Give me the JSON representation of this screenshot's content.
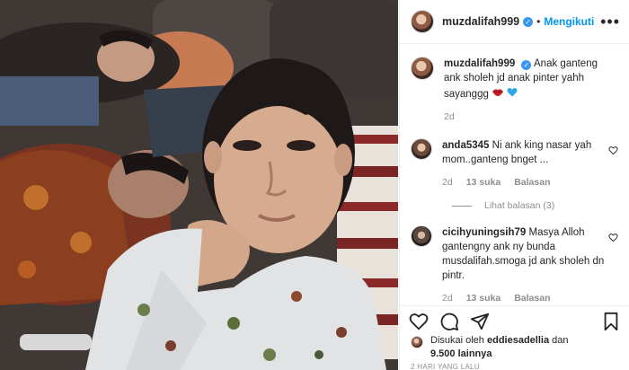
{
  "post": {
    "username": "muzdalifah999",
    "dot": "•",
    "follow_label": "Mengikuti",
    "more_label": "•••",
    "caption_text": "Anak ganteng ank sholeh jd anak pinter yahh sayanggg",
    "caption_emoji": [
      "lips-emoji",
      "blue-heart-emoji"
    ],
    "caption_age": "2d"
  },
  "comments": [
    {
      "username": "anda5345",
      "text": "Ni ank king nasar yah mom..ganteng bnget ...",
      "age": "2d",
      "likes": "13 suka",
      "reply_label": "Balasan",
      "view_replies": "Lihat balasan (3)"
    },
    {
      "username": "cicihyuningsih79",
      "text": "Masya Alloh gantengny ank ny bunda musdalifah.smoga jd ank sholeh dn pintr.",
      "age": "2d",
      "likes": "13 suka",
      "reply_label": "Balasan"
    }
  ],
  "likes": {
    "prefix": "Disukai oleh",
    "liker": "eddiesadellia",
    "and": "dan",
    "count": "9.500 lainnya"
  },
  "timestamp": "2 HARI YANG LALU",
  "colors": {
    "link_blue": "#0095f6",
    "verified_blue": "#3897f0",
    "muted": "#8e8e8e",
    "text": "#262626"
  }
}
